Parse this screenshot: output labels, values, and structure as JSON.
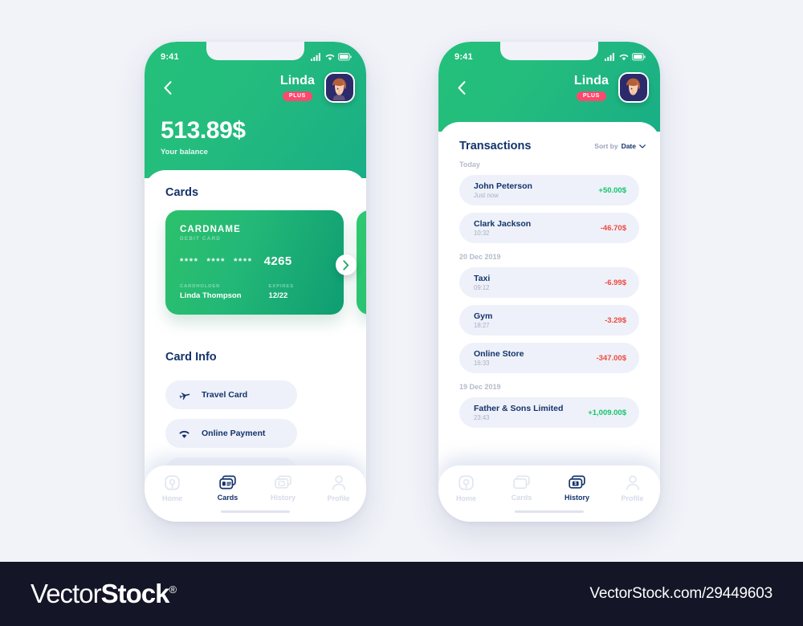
{
  "colors": {
    "green_start": "#24c07a",
    "green_end": "#19ae86",
    "navy": "#13336b",
    "accent_pink": "#fb4a6e",
    "positive": "#13c56b",
    "negative": "#f0483f",
    "chip_bg": "#eef1f9",
    "page_bg": "#f2f3f9"
  },
  "status_bar": {
    "time": "9:41"
  },
  "header": {
    "back_label": "Back",
    "user_name": "Linda",
    "badge": "PLUS",
    "avatar_name": "Linda"
  },
  "screen1": {
    "balance": "513.89$",
    "balance_label": "Your balance",
    "cards_title": "Cards",
    "card": {
      "name": "CARDNAME",
      "type": "DEBIT CARD",
      "masked_groups": [
        "****",
        "****",
        "****"
      ],
      "last4": "4265",
      "holder_label": "CARDHOLDER",
      "holder_value": "Linda Thompson",
      "expires_label": "EXPIRES",
      "expires_value": "12/22"
    },
    "card_info_title": "Card Info",
    "info_rows": [
      {
        "label": "Travel Card",
        "icon": "airplane-icon"
      },
      {
        "label": "Online Payment",
        "icon": "wifi-icon"
      }
    ],
    "tabs": [
      {
        "label": "Home",
        "icon": "home-icon",
        "active": false
      },
      {
        "label": "Cards",
        "icon": "cards-icon",
        "active": true
      },
      {
        "label": "History",
        "icon": "history-icon",
        "active": false
      },
      {
        "label": "Profile",
        "icon": "profile-icon",
        "active": false
      }
    ]
  },
  "screen2": {
    "title": "Transactions",
    "sort_prefix": "Sort by",
    "sort_value": "Date",
    "groups": [
      {
        "label": "Today",
        "items": [
          {
            "name": "John Peterson",
            "time": "Just now",
            "amount": "+50.00$",
            "sign": "pos"
          },
          {
            "name": "Clark Jackson",
            "time": "10:32",
            "amount": "-46.70$",
            "sign": "neg"
          }
        ]
      },
      {
        "label": "20 Dec 2019",
        "items": [
          {
            "name": "Taxi",
            "time": "09:12",
            "amount": "-6.99$",
            "sign": "neg"
          },
          {
            "name": "Gym",
            "time": "18:27",
            "amount": "-3.29$",
            "sign": "neg"
          },
          {
            "name": "Online Store",
            "time": "16:33",
            "amount": "-347.00$",
            "sign": "neg"
          }
        ]
      },
      {
        "label": "19 Dec 2019",
        "items": [
          {
            "name": "Father & Sons Limited",
            "time": "23:43",
            "amount": "+1,009.00$",
            "sign": "pos"
          }
        ]
      }
    ],
    "tabs": [
      {
        "label": "Home",
        "icon": "home-icon",
        "active": false
      },
      {
        "label": "Cards",
        "icon": "cards-icon",
        "active": false
      },
      {
        "label": "History",
        "icon": "history-icon",
        "active": true
      },
      {
        "label": "Profile",
        "icon": "profile-icon",
        "active": false
      }
    ]
  },
  "footer": {
    "brand_part1": "Vector",
    "brand_part2": "Stock",
    "brand_mark": "®",
    "url": "VectorStock.com/29449603"
  }
}
